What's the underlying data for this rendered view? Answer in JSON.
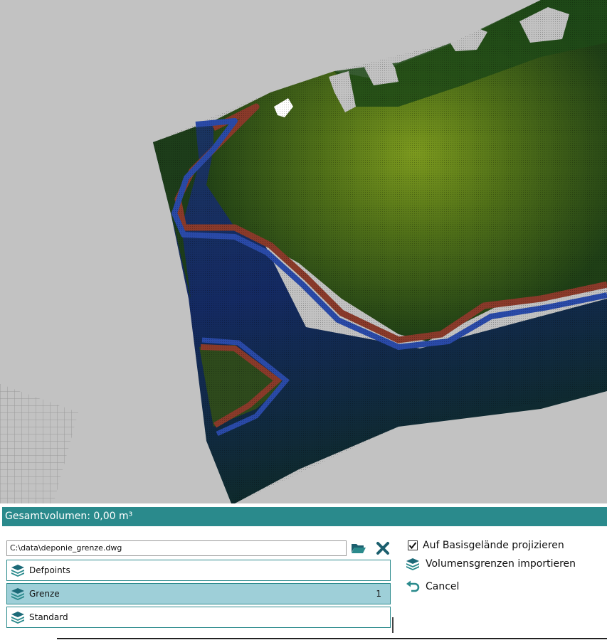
{
  "panel": {
    "title": "Gesamtvolumen: 0,00 m³",
    "file_path": "C:\\data\\deponie_grenze.dwg",
    "layers": [
      {
        "label": "Defpoints",
        "count": "",
        "selected": false
      },
      {
        "label": "Grenze",
        "count": "1",
        "selected": true
      },
      {
        "label": "Standard",
        "count": "",
        "selected": false
      }
    ],
    "project_checkbox_label": "Auf Basisgelände projizieren",
    "project_checked": true,
    "import_label": "Volumensgrenzen importieren",
    "cancel_label": "Cancel"
  },
  "colors": {
    "accent": "#2a8a8c",
    "selected_row": "#9ecfd8",
    "viewport_bg": "#c2c2c2",
    "terrain_dark": "#1f3d1a",
    "terrain_light": "#7a9a1c",
    "boundary_red": "#8a3a2a",
    "boundary_blue": "#2a4aa8",
    "low_terrain": "#162a55"
  },
  "icons": {
    "open": "folder-open-icon",
    "clear": "close-icon",
    "layer": "layers-icon",
    "undo": "undo-icon"
  }
}
